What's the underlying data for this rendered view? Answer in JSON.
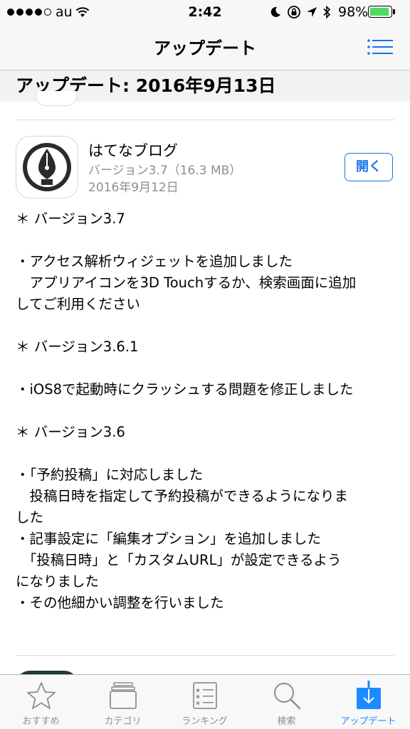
{
  "status_bar": {
    "carrier": "au",
    "time": "2:42",
    "battery": "98%",
    "battery_level": 0.98
  },
  "nav": {
    "title": "アップデート"
  },
  "section": {
    "title": "アップデート: 2016年9月13日"
  },
  "app": {
    "name": "はてなブログ",
    "version": "バージョン3.7（16.3 MB）",
    "date": "2016年9月12日",
    "open_label": "開く"
  },
  "release_notes": [
    "＊ バージョン3.7",
    "",
    "・アクセス解析ウィジェットを追加しました",
    "　アプリアイコンを3D Touchするか、検索画面に追加",
    "してご利用ください",
    "",
    "＊ バージョン3.6.1",
    "",
    "・iOS8で起動時にクラッシュする問題を修正しました",
    "",
    "＊ バージョン3.6",
    "",
    "・「予約投稿」に対応しました",
    "　投稿日時を指定して予約投稿ができるようになりま",
    "した",
    "・記事設定に「編集オプション」を追加しました",
    "　「投稿日時」と「カスタムURL」が設定できるよう",
    "になりました",
    "・その他細かい調整を行いました"
  ],
  "tabs": [
    {
      "label": "おすすめ",
      "icon": "star-icon",
      "active": false
    },
    {
      "label": "カテゴリ",
      "icon": "categories-icon",
      "active": false
    },
    {
      "label": "ランキング",
      "icon": "ranking-list-icon",
      "active": false
    },
    {
      "label": "検索",
      "icon": "search-icon",
      "active": false
    },
    {
      "label": "アップデート",
      "icon": "updates-download-icon",
      "active": true
    }
  ],
  "colors": {
    "accent": "#1a73e8",
    "tab_active": "#1a8cff",
    "tab_inactive": "#8e8e93",
    "battery": "#4cd964"
  }
}
